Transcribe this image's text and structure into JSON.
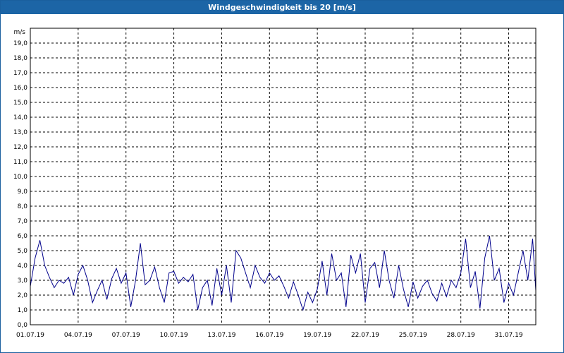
{
  "window": {
    "title": "Windgeschwindigkeit bis 20 [m/s]"
  },
  "chart_data": {
    "type": "line",
    "title": "Windgeschwindigkeit bis 20 [m/s]",
    "unit_label": "m/s",
    "ylim": [
      0,
      20
    ],
    "y_ticks": [
      "0,0",
      "1,0",
      "2,0",
      "3,0",
      "4,0",
      "5,0",
      "6,0",
      "7,0",
      "8,0",
      "9,0",
      "10,0",
      "11,0",
      "12,0",
      "13,0",
      "14,0",
      "15,0",
      "16,0",
      "17,0",
      "18,0",
      "19,0"
    ],
    "x_ticks": [
      "01.07.19",
      "04.07.19",
      "07.07.19",
      "10.07.19",
      "13.07.19",
      "16.07.19",
      "19.07.19",
      "22.07.19",
      "25.07.19",
      "28.07.19",
      "31.07.19"
    ],
    "x_range_days": [
      0,
      31.7
    ],
    "grid": true,
    "colors": {
      "line": "#00008b",
      "grid": "#000000",
      "title_bar": "#1c65a6"
    },
    "series": [
      {
        "x_days": [
          0.0,
          0.3,
          0.6,
          0.9,
          1.2,
          1.5,
          1.8,
          2.1,
          2.4,
          2.7,
          3.0,
          3.3,
          3.6,
          3.9,
          4.2,
          4.5,
          4.8,
          5.1,
          5.4,
          5.7,
          6.0,
          6.3,
          6.6,
          6.9,
          7.2,
          7.5,
          7.8,
          8.1,
          8.4,
          8.7,
          9.0,
          9.3,
          9.6,
          9.9,
          10.2,
          10.5,
          10.8,
          11.1,
          11.4,
          11.7,
          12.0,
          12.3,
          12.6,
          12.9,
          13.2,
          13.5,
          13.8,
          14.1,
          14.4,
          14.7,
          15.0,
          15.3,
          15.6,
          15.9,
          16.2,
          16.5,
          16.8,
          17.1,
          17.4,
          17.7,
          18.0,
          18.3,
          18.6,
          18.9,
          19.2,
          19.5,
          19.8,
          20.1,
          20.4,
          20.7,
          21.0,
          21.3,
          21.6,
          21.9,
          22.2,
          22.5,
          22.8,
          23.1,
          23.4,
          23.7,
          24.0,
          24.3,
          24.6,
          24.9,
          25.2,
          25.5,
          25.8,
          26.1,
          26.4,
          26.7,
          27.0,
          27.3,
          27.6,
          27.9,
          28.2,
          28.5,
          28.8,
          29.1,
          29.4,
          29.7,
          30.0,
          30.3,
          30.6,
          30.9,
          31.2,
          31.5,
          31.7
        ],
        "values": [
          2.6,
          4.5,
          5.7,
          4.0,
          3.2,
          2.5,
          3.0,
          2.8,
          3.2,
          2.0,
          3.4,
          4.0,
          3.0,
          1.5,
          2.3,
          3.0,
          1.7,
          3.1,
          3.8,
          2.8,
          3.5,
          1.2,
          3.0,
          5.5,
          2.7,
          3.0,
          3.9,
          2.5,
          1.5,
          3.5,
          3.6,
          2.8,
          3.2,
          2.9,
          3.4,
          1.0,
          2.5,
          3.0,
          1.3,
          3.8,
          2.0,
          4.0,
          1.5,
          5.0,
          4.5,
          3.5,
          2.5,
          4.0,
          3.2,
          2.8,
          3.5,
          3.0,
          3.3,
          2.6,
          1.8,
          2.9,
          2.0,
          1.0,
          2.2,
          1.5,
          2.4,
          4.3,
          2.0,
          4.8,
          3.0,
          3.5,
          1.2,
          4.7,
          3.5,
          4.8,
          1.5,
          3.8,
          4.2,
          2.5,
          5.0,
          3.0,
          1.8,
          4.0,
          2.4,
          1.2,
          2.9,
          1.8,
          2.6,
          3.0,
          2.1,
          1.6,
          2.8,
          1.9,
          3.0,
          2.5,
          3.5,
          5.8,
          2.5,
          3.6,
          1.1,
          4.5,
          6.0,
          3.0,
          3.8,
          1.5,
          2.8,
          2.0,
          3.5,
          5.0,
          3.0,
          5.8,
          2.3
        ]
      }
    ]
  }
}
